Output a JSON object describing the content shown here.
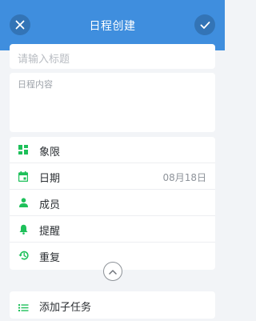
{
  "header": {
    "title": "日程创建",
    "close_icon": "close-icon",
    "confirm_icon": "check-icon",
    "color": "#3f8ede"
  },
  "form": {
    "title_placeholder": "请输入标题",
    "content_placeholder": "日程内容"
  },
  "fields": [
    {
      "label": "象限",
      "icon": "grid-icon",
      "value": ""
    },
    {
      "label": "日期",
      "icon": "calendar-icon",
      "value": "08月18日"
    },
    {
      "label": "成员",
      "icon": "person-icon",
      "value": ""
    },
    {
      "label": "提醒",
      "icon": "bell-icon",
      "value": ""
    },
    {
      "label": "重复",
      "icon": "history-icon",
      "value": ""
    }
  ],
  "collapse_icon": "chevron-up-icon",
  "subtask": {
    "label": "添加子任务",
    "icon": "list-icon"
  },
  "accent_green": "#1ec05a"
}
